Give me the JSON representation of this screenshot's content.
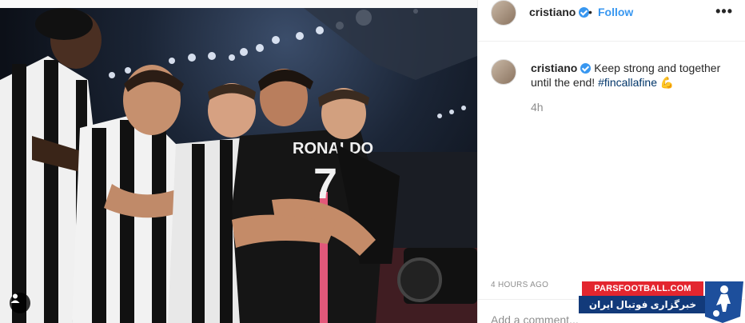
{
  "post": {
    "username": "cristiano",
    "follow_label": "Follow",
    "separator": "•",
    "more_label": "•••",
    "caption_text": "Keep strong and together until the end!",
    "hashtag": "#fincallafine",
    "emoji": "💪",
    "relative_time": "4h",
    "absolute_time": "4 HOURS AGO",
    "add_comment_placeholder": "Add a comment..."
  },
  "photo": {
    "jersey_name": "RONALDO",
    "jersey_number": "7"
  },
  "watermark": {
    "site": "PARSFOOTBALL.COM",
    "tagline": "خبرگزاری فوتبال ایران"
  },
  "colors": {
    "link_blue": "#3897f0",
    "hashtag_blue": "#003569",
    "muted_gray": "#8e8e8e",
    "watermark_red": "#e3262f",
    "watermark_blue": "#123a7a"
  },
  "icons": {
    "verified": "verified-badge-icon",
    "user_tag": "user-tag-icon",
    "more": "more-options-icon",
    "player_logo": "footballer-logo-icon"
  }
}
